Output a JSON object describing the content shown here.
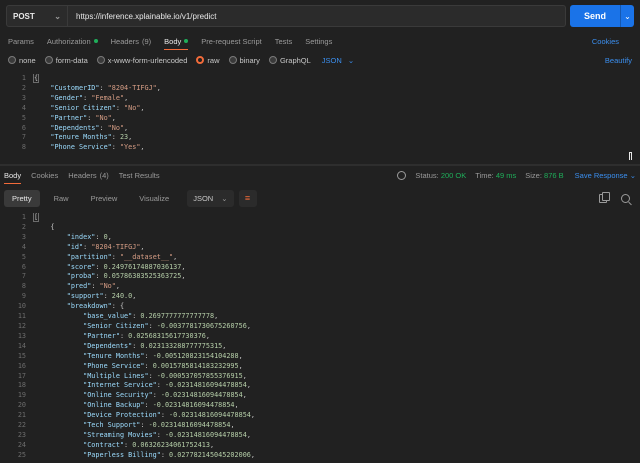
{
  "request": {
    "method": "POST",
    "url": "https://inference.xplainable.io/v1/predict",
    "send_label": "Send"
  },
  "request_tabs": [
    {
      "label": "Params"
    },
    {
      "label": "Authorization",
      "dot": true
    },
    {
      "label": "Headers",
      "count": "(9)"
    },
    {
      "label": "Body",
      "dot": true,
      "active": true
    },
    {
      "label": "Pre-request Script"
    },
    {
      "label": "Tests"
    },
    {
      "label": "Settings"
    }
  ],
  "cookies_label": "Cookies",
  "body_types": [
    {
      "label": "none"
    },
    {
      "label": "form-data"
    },
    {
      "label": "x-www-form-urlencoded"
    },
    {
      "label": "raw",
      "selected": true
    },
    {
      "label": "binary"
    },
    {
      "label": "GraphQL"
    }
  ],
  "raw_format": "JSON",
  "beautify_label": "Beautify",
  "request_body": [
    "{",
    "    \"CustomerID\": \"8204-TIFGJ\",",
    "    \"Gender\": \"Female\",",
    "    \"Senior Citizen\": \"No\",",
    "    \"Partner\": \"No\",",
    "    \"Dependents\": \"No\",",
    "    \"Tenure Months\": 23,",
    "    \"Phone Service\": \"Yes\","
  ],
  "response_tabs": [
    {
      "label": "Body",
      "active": true
    },
    {
      "label": "Cookies"
    },
    {
      "label": "Headers",
      "count": "(4)"
    },
    {
      "label": "Test Results"
    }
  ],
  "response_meta": {
    "status_label": "Status:",
    "status_value": "200 OK",
    "time_label": "Time:",
    "time_value": "49 ms",
    "size_label": "Size:",
    "size_value": "876 B",
    "save_label": "Save Response"
  },
  "view_modes": [
    {
      "label": "Pretty",
      "active": true
    },
    {
      "label": "Raw"
    },
    {
      "label": "Preview"
    },
    {
      "label": "Visualize"
    }
  ],
  "response_format": "JSON",
  "response_body": [
    "[",
    "    {",
    "        \"index\": 0,",
    "        \"id\": \"8204-TIFGJ\",",
    "        \"partition\": \"__dataset__\",",
    "        \"score\": 0.24976174887036137,",
    "        \"proba\": 0.05786383525363725,",
    "        \"pred\": \"No\",",
    "        \"support\": 240.0,",
    "        \"breakdown\": {",
    "            \"base_value\": 0.2697777777777778,",
    "            \"Senior Citizen\": -0.0037781730675260756,",
    "            \"Partner\": 0.02568315617730376,",
    "            \"Dependents\": 0.023133288777775315,",
    "            \"Tenure Months\": -0.005120823154104288,",
    "            \"Phone Service\": 0.0015785814183232995,",
    "            \"Multiple Lines\": -0.000537057855376915,",
    "            \"Internet Service\": -0.02314816094478854,",
    "            \"Online Security\": -0.02314816094478854,",
    "            \"Online Backup\": -0.02314816094478854,",
    "            \"Device Protection\": -0.02314816094478854,",
    "            \"Tech Support\": -0.02314816094478854,",
    "            \"Streaming Movies\": -0.02314816094478854,",
    "            \"Contract\": 0.06326234061752413,",
    "            \"Paperless Billing\": 0.027782145045202006,"
  ],
  "icons": {
    "method_dropdown": "chevron-down-icon",
    "copy": "copy-icon",
    "search": "search-icon",
    "wrap": "wrap-lines-icon",
    "globe": "globe-icon"
  },
  "colors": {
    "accent": "#f26b3a",
    "link": "#3b8fef",
    "send": "#1a73e8",
    "status_ok": "#1fae5a"
  }
}
